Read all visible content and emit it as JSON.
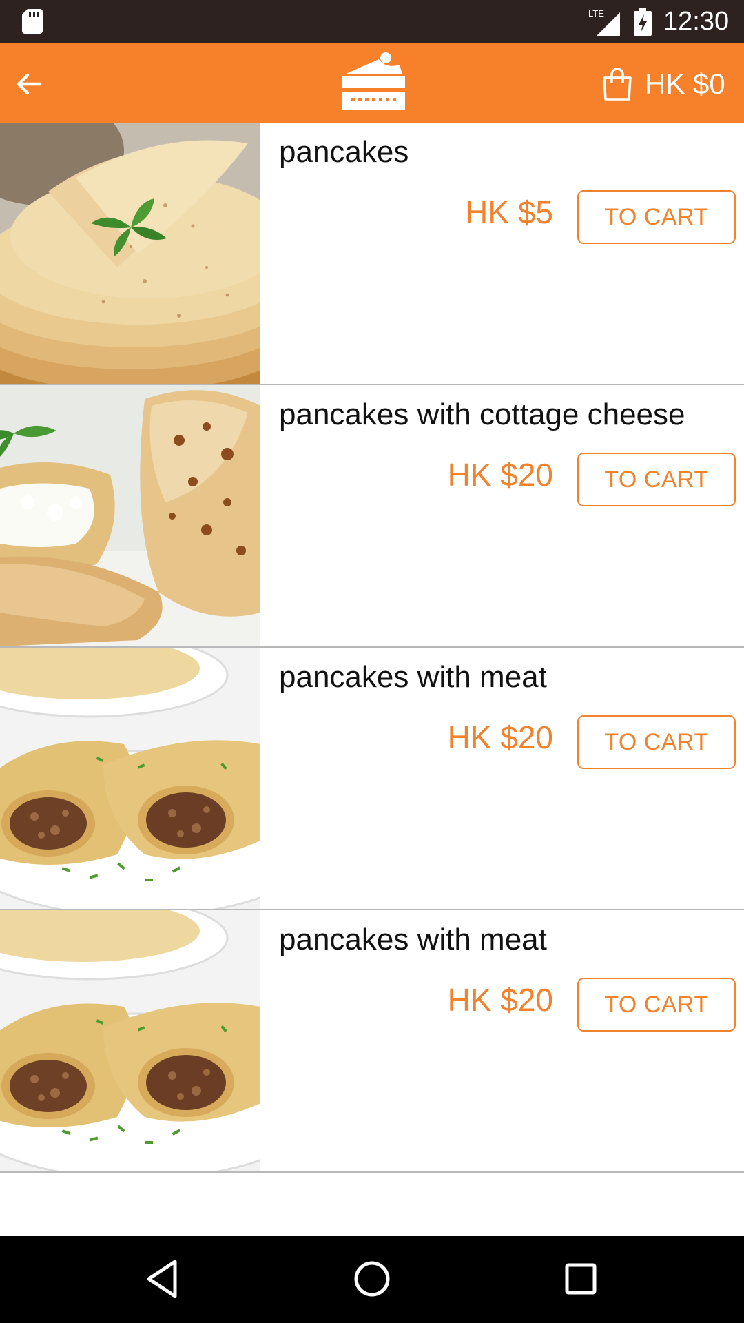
{
  "status_bar": {
    "time": "12:30",
    "network": "LTE",
    "icons": [
      "sd-card-icon",
      "signal-icon",
      "battery-charging-icon"
    ]
  },
  "app_bar": {
    "back_icon": "arrow-left-icon",
    "logo_icon": "cake-slice-icon",
    "cart_icon": "shopping-bag-icon",
    "cart_total": "HK $0"
  },
  "colors": {
    "primary": "#f6812a",
    "price": "#f2822c",
    "status_bar": "#2e2220",
    "nav_bar": "#000000"
  },
  "products": [
    {
      "name": "pancakes",
      "price": "HK $5",
      "button_label": "TO CART",
      "image": "stacked-crepes-with-mint"
    },
    {
      "name": "pancakes with cottage cheese",
      "price": "HK $20",
      "button_label": "TO CART",
      "image": "crepes-with-cottage-cheese"
    },
    {
      "name": "pancakes with meat",
      "price": "HK $20",
      "button_label": "TO CART",
      "image": "crepes-with-minced-meat"
    },
    {
      "name": "pancakes with meat",
      "price": "HK $20",
      "button_label": "TO CART",
      "image": "crepes-with-minced-meat"
    }
  ],
  "nav_bar": {
    "icons": [
      "back-triangle-icon",
      "home-circle-icon",
      "recents-square-icon"
    ]
  }
}
